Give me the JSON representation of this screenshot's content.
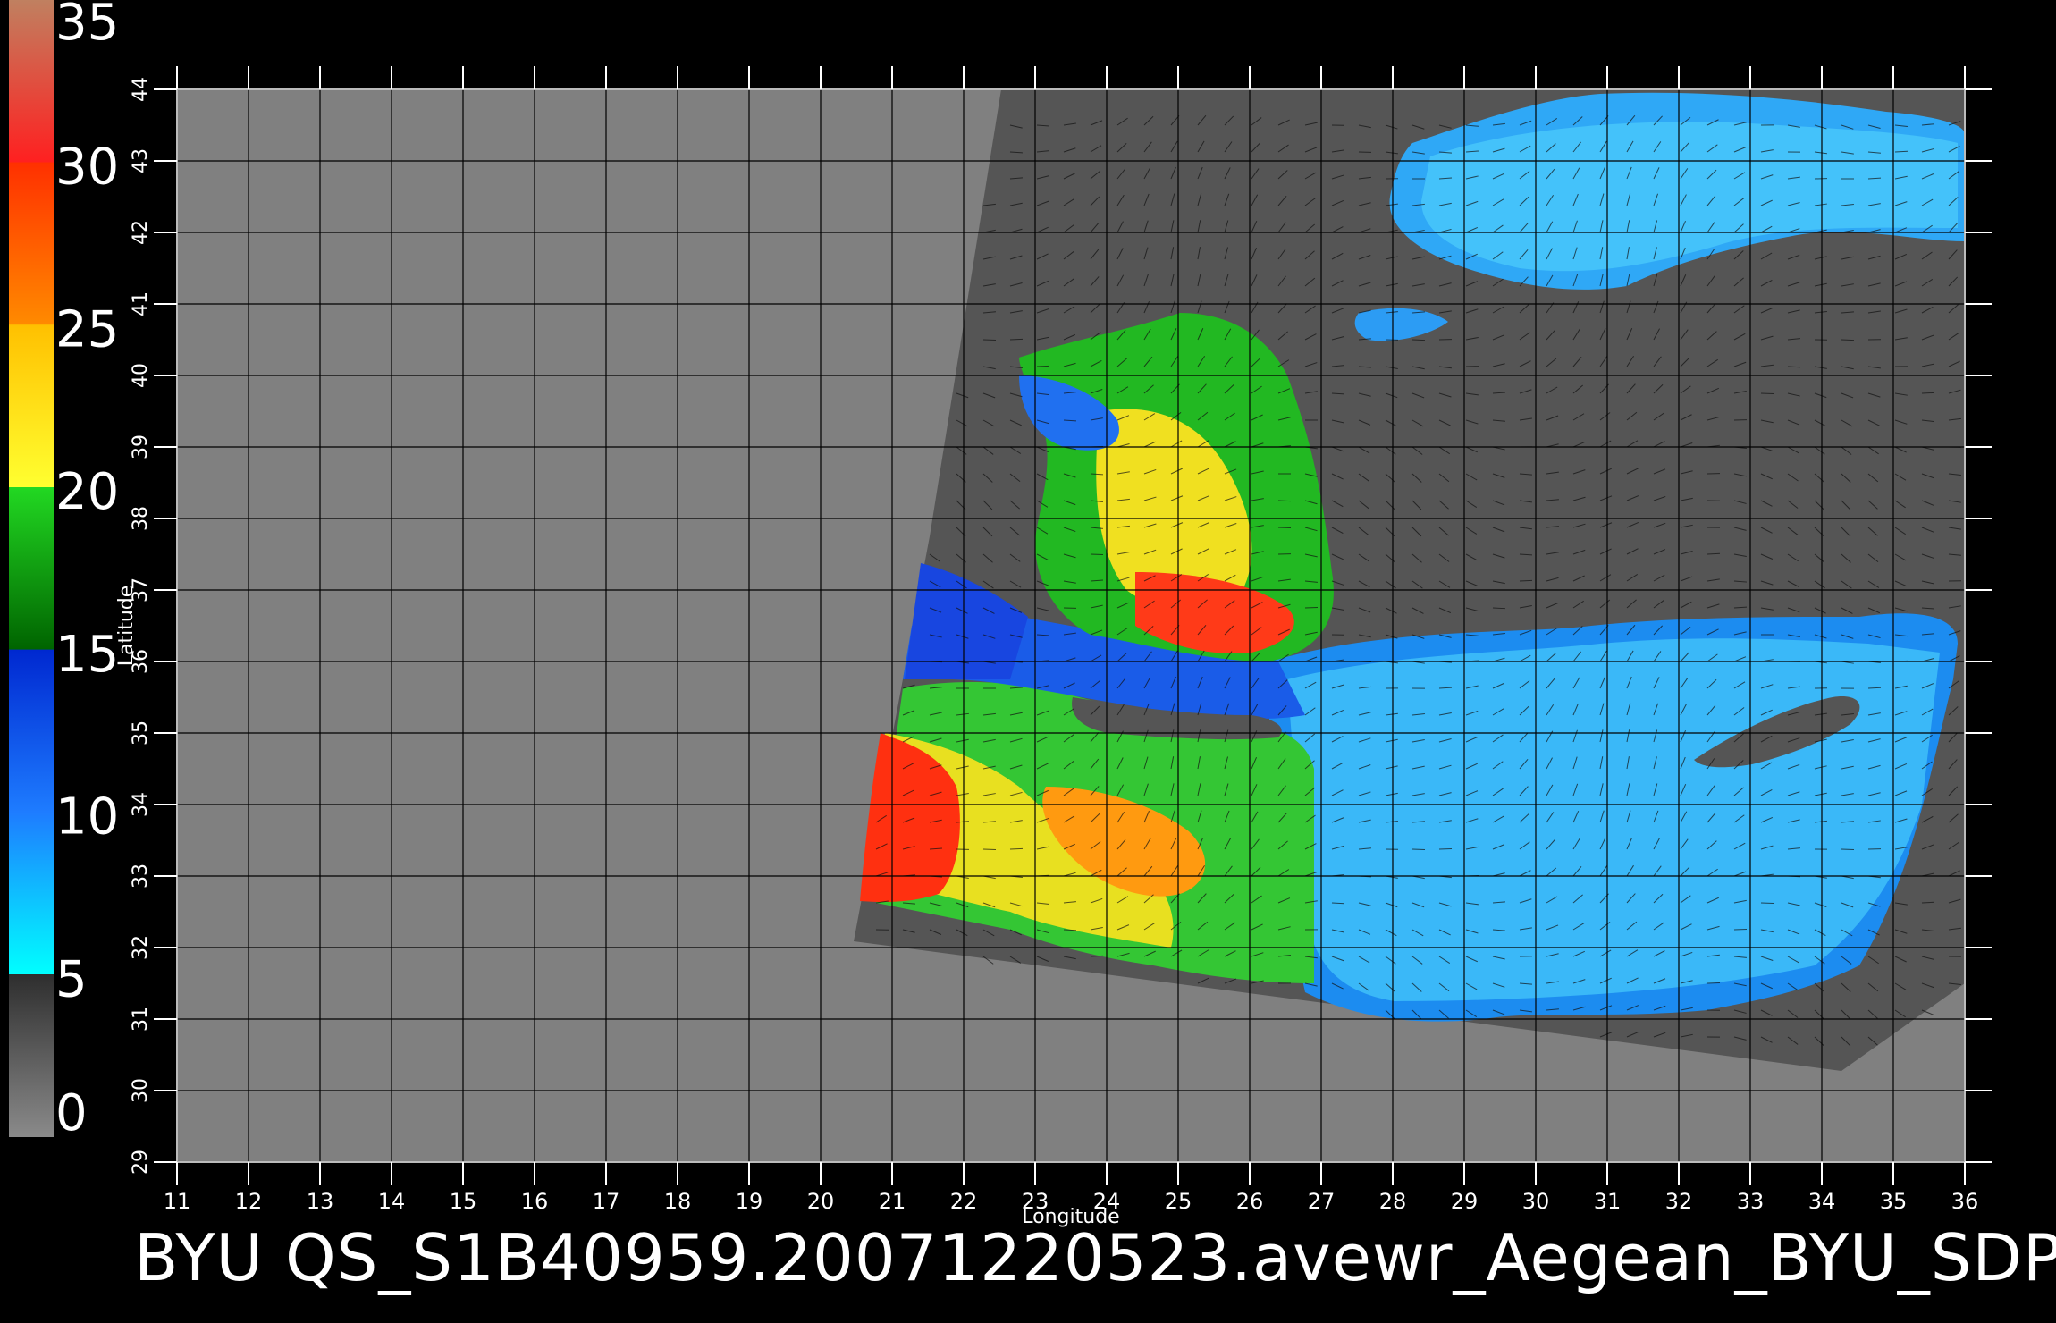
{
  "caption": "BYU  QS_S1B40959.20071220523.avewr_Aegean_BYU_SDP",
  "axes": {
    "xlabel": "Longitude",
    "ylabel": "Latitude",
    "longitude_ticks": [
      "11",
      "12",
      "13",
      "14",
      "15",
      "16",
      "17",
      "18",
      "19",
      "20",
      "21",
      "22",
      "23",
      "24",
      "25",
      "26",
      "27",
      "28",
      "29",
      "30",
      "31",
      "32",
      "33",
      "34",
      "35",
      "36"
    ],
    "latitude_ticks": [
      "29",
      "30",
      "31",
      "32",
      "33",
      "34",
      "35",
      "36",
      "37",
      "38",
      "39",
      "40",
      "41",
      "42",
      "43",
      "44"
    ],
    "lon_range": [
      11,
      36
    ],
    "lat_range": [
      29,
      44
    ]
  },
  "colorbar": {
    "tick_labels": [
      "0",
      "5",
      "10",
      "15",
      "20",
      "25",
      "30",
      "35"
    ],
    "range": [
      0,
      35
    ],
    "stops": [
      {
        "value": 0,
        "color": "#8a8a8a"
      },
      {
        "value": 5,
        "color": "#2e2e2e"
      },
      {
        "value": 5.01,
        "color": "#00ffff"
      },
      {
        "value": 10,
        "color": "#1e7cff"
      },
      {
        "value": 15,
        "color": "#0028d0"
      },
      {
        "value": 15.01,
        "color": "#006400"
      },
      {
        "value": 20,
        "color": "#22d822"
      },
      {
        "value": 20.01,
        "color": "#ffff30"
      },
      {
        "value": 25,
        "color": "#ffc000"
      },
      {
        "value": 25.01,
        "color": "#ff8a00"
      },
      {
        "value": 30,
        "color": "#ff3000"
      },
      {
        "value": 30.01,
        "color": "#ff2020"
      },
      {
        "value": 35,
        "color": "#c08060"
      }
    ]
  },
  "colors": {
    "background": "#000000",
    "land": "#808080",
    "swath_nodata": "#555555",
    "grid": "#000000"
  }
}
